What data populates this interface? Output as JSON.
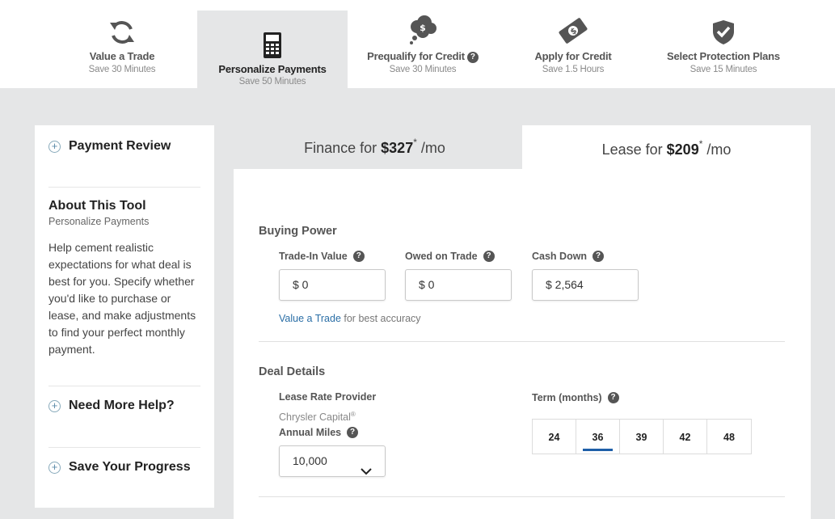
{
  "steps": [
    {
      "title": "Value a Trade",
      "sub": "Save 30 Minutes",
      "icon": "refresh-icon"
    },
    {
      "title": "Personalize Payments",
      "sub": "Save 50 Minutes",
      "icon": "calculator-icon",
      "active": true
    },
    {
      "title": "Prequalify for Credit",
      "sub": "Save 30 Minutes",
      "icon": "money-cloud-icon",
      "help": "?"
    },
    {
      "title": "Apply for Credit",
      "sub": "Save 1.5 Hours",
      "icon": "dollar-bill-icon"
    },
    {
      "title": "Select Protection Plans",
      "sub": "Save 15 Minutes",
      "icon": "shield-check-icon"
    }
  ],
  "sidebar": {
    "payment_review": "Payment Review",
    "about_title": "About This Tool",
    "about_sub": "Personalize Payments",
    "about_text": "Help cement realistic expectations for what deal is best for you. Specify whether you'd like to purchase or lease, and make adjustments to find your perfect monthly payment.",
    "need_help": "Need More Help?",
    "save_progress": "Save Your Progress",
    "plus": "+"
  },
  "tabs": {
    "finance": {
      "prefix": "Finance for ",
      "amount": "$327",
      "star": "*",
      "suffix": " /mo"
    },
    "lease": {
      "prefix": "Lease for ",
      "amount": "$209",
      "star": "*",
      "suffix": " /mo"
    }
  },
  "buying_power": {
    "heading": "Buying Power",
    "trade_in_label": "Trade-In Value",
    "trade_in_value": "$ 0",
    "owed_label": "Owed on Trade",
    "owed_value": "$ 0",
    "cash_label": "Cash Down",
    "cash_value": "$ 2,564",
    "helper_link": "Value a Trade",
    "helper_text": " for best accuracy",
    "help": "?"
  },
  "deal_details": {
    "heading": "Deal Details",
    "provider_label": "Lease Rate Provider",
    "provider_value": "Chrysler Capital",
    "provider_mark": "®",
    "miles_label": "Annual Miles",
    "miles_value": "10,000",
    "term_label": "Term (months)",
    "terms": [
      "24",
      "36",
      "39",
      "42",
      "48"
    ],
    "selected_term": "36",
    "help": "?"
  },
  "colors": {
    "accent": "#1e5fa8",
    "link": "#2a6ea6",
    "background": "#e5e6e7",
    "icon": "#555555"
  }
}
